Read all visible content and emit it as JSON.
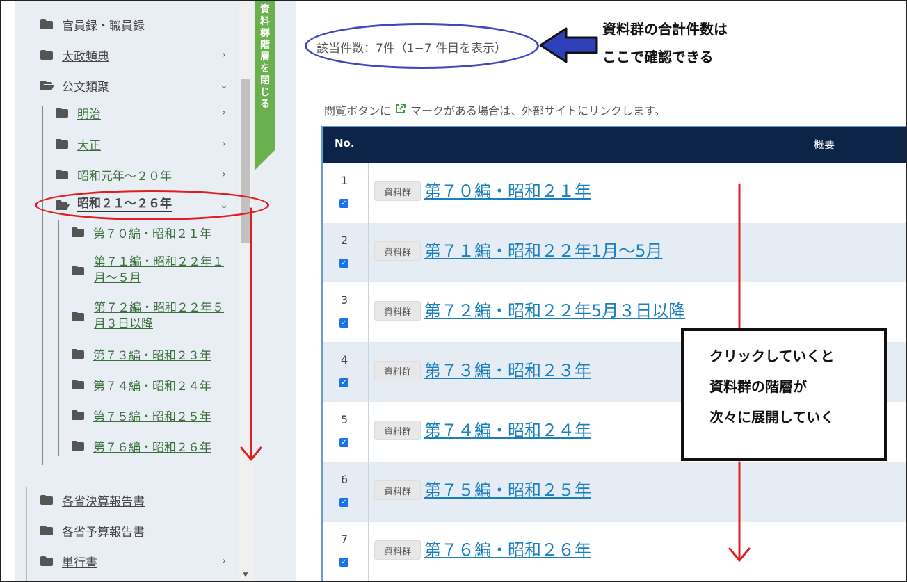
{
  "sidebar": {
    "items": [
      {
        "label": "官員録・職員録"
      },
      {
        "label": "太政類典"
      },
      {
        "label": "公文類聚"
      },
      {
        "label": "明治"
      },
      {
        "label": "大正"
      },
      {
        "label": "昭和元年～２０年"
      },
      {
        "label": "昭和２１～２６年"
      },
      {
        "label": "第７０編・昭和２１年"
      },
      {
        "label_line1": "第７１編・昭和２２年１",
        "label_line2": "月～５月"
      },
      {
        "label_line1": "第７２編・昭和２２年５",
        "label_line2": "月３日以降"
      },
      {
        "label": "第７３編・昭和２３年"
      },
      {
        "label": "第７４編・昭和２４年"
      },
      {
        "label": "第７５編・昭和２５年"
      },
      {
        "label": "第７６編・昭和２６年"
      },
      {
        "label": "各省決算報告書"
      },
      {
        "label": "各省予算報告書"
      },
      {
        "label": "単行書"
      }
    ],
    "collapse_tab": "資料群階層を閉じる"
  },
  "main": {
    "count_text": "該当件数：7件（1−7 件目を表示）",
    "note_before": "閲覧ボタンに",
    "note_after": "マークがある場合は、外部サイトにリンクします。",
    "table": {
      "headers": {
        "no": "No.",
        "summary": "概要"
      },
      "badge": "資料群",
      "rows": [
        {
          "no": "1",
          "title": "第７０編・昭和２１年"
        },
        {
          "no": "2",
          "title": "第７１編・昭和２２年1月～5月"
        },
        {
          "no": "3",
          "title": "第７２編・昭和２２年5月３日以降"
        },
        {
          "no": "4",
          "title": "第７３編・昭和２３年"
        },
        {
          "no": "5",
          "title": "第７４編・昭和２４年"
        },
        {
          "no": "6",
          "title": "第７５編・昭和２５年"
        },
        {
          "no": "7",
          "title": "第７６編・昭和２６年"
        }
      ]
    }
  },
  "annotations": {
    "callout_top_line1": "資料群の合計件数は",
    "callout_top_line2": "ここで確認できる",
    "box_line1": "クリックしていくと",
    "box_line2": "資料群の階層が",
    "box_line3": "次々に展開していく",
    "colors": {
      "red": "#e02020",
      "blue": "#4048c0",
      "header": "#0b2447",
      "green_tab": "#6ab04c"
    }
  }
}
